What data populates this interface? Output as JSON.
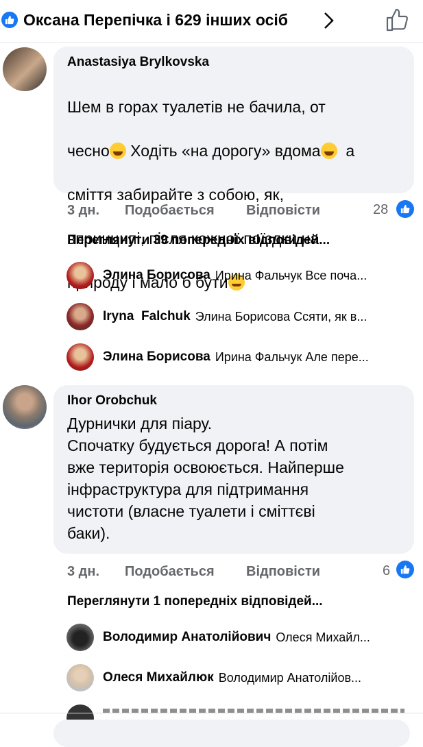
{
  "header": {
    "title": "Оксана Перепічка і 629 інших осіб"
  },
  "comments": [
    {
      "author": "Anastasiya Brylkovska",
      "lines": [
        "Шем в горах туалетів не бачила, от",
        "чесно",
        " Ходіть «на дорогу» вдома",
        "  а",
        "сміття забирайте з собою, як,",
        "впринципі, після кожної поїздки на",
        "природу і мало б бути"
      ],
      "time": "3 дн.",
      "like_label": "Подобається",
      "reply_label": "Відповісти",
      "reaction_count": "28",
      "view_previous": "Переглянути 39 попередніх відповідей...",
      "replies": [
        {
          "name": "Элина Борисова",
          "snippet": "Ирина Фальчук Все поча..."
        },
        {
          "name": "Iryna  Falchuk",
          "snippet": "Элина Борисова Ссяти, як в..."
        },
        {
          "name": "Элина Борисова",
          "snippet": "Ирина Фальчук Але пере..."
        }
      ]
    },
    {
      "author": "Ihor Orobchuk",
      "text": "Дурнички для піару.\nСпочатку будується дорога! А потім\nвже територія освоюється. Найперше\nінфраструктура для підтримання\nчистоти (власне туалети і сміттєві\nбаки).",
      "time": "3 дн.",
      "like_label": "Подобається",
      "reply_label": "Відповісти",
      "reaction_count": "6",
      "view_previous": "Переглянути 1 попередніх відповідей...",
      "replies": [
        {
          "name": "Володимир Анатолійович",
          "snippet": "Олеся Михайл..."
        },
        {
          "name": "Олеся Михайлюк",
          "snippet": "Володимир Анатолійов..."
        }
      ]
    }
  ],
  "colors": {
    "accent": "#1877f2",
    "bubble": "#f0f2f5",
    "meta": "#65676b"
  }
}
